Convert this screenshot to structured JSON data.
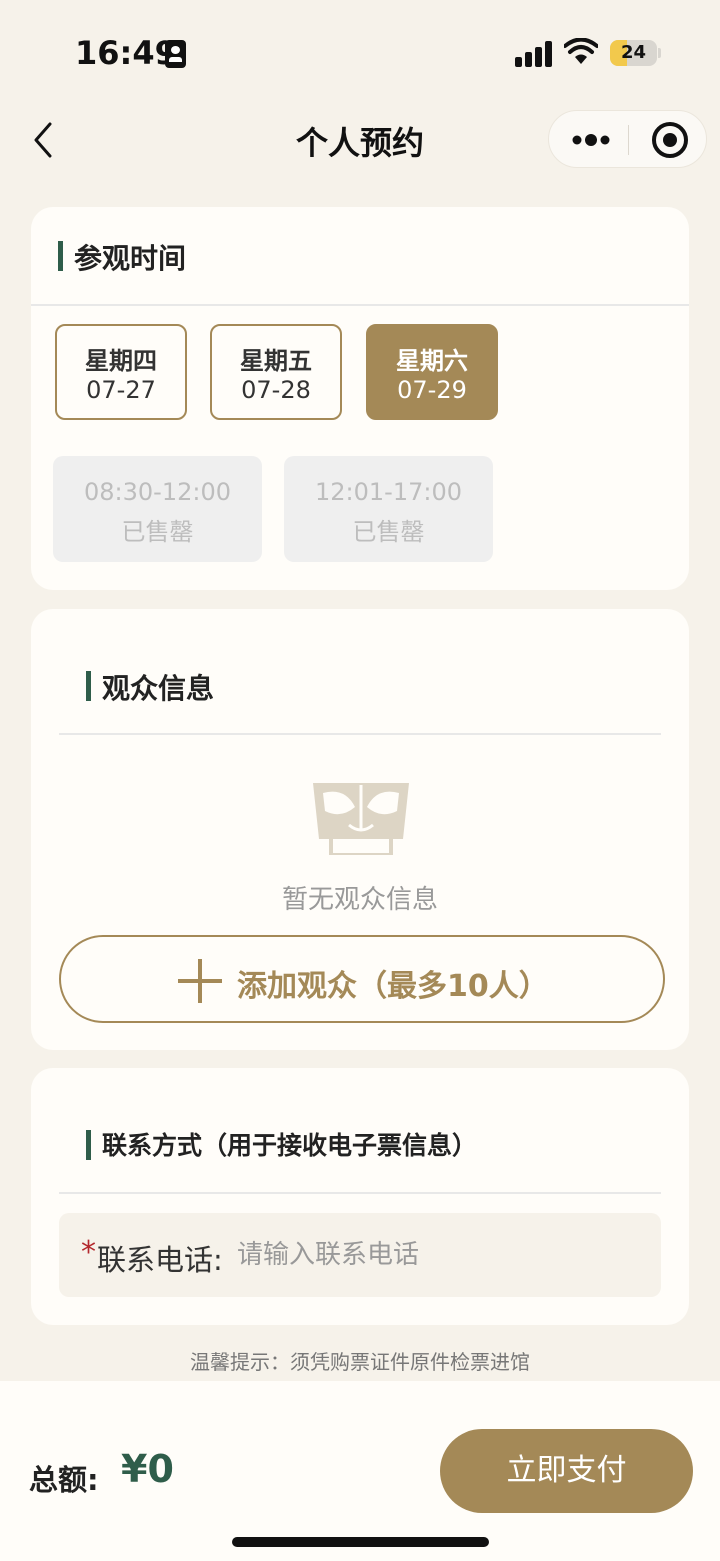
{
  "status_bar": {
    "time": "16:49",
    "battery": "24"
  },
  "nav": {
    "title": "个人预约"
  },
  "visit_time": {
    "title": "参观时间",
    "dates": [
      {
        "weekday": "星期四",
        "date": "07-27",
        "selected": false
      },
      {
        "weekday": "星期五",
        "date": "07-28",
        "selected": false
      },
      {
        "weekday": "星期六",
        "date": "07-29",
        "selected": true
      }
    ],
    "slots": [
      {
        "time": "08:30-12:00",
        "status": "已售罄"
      },
      {
        "time": "12:01-17:00",
        "status": "已售罄"
      }
    ]
  },
  "audience": {
    "title": "观众信息",
    "empty_text": "暂无观众信息",
    "add_label": "添加观众（最多10人）"
  },
  "contact": {
    "title": "联系方式（用于接收电子票信息）",
    "required_mark": "*",
    "phone_label": "联系电话:",
    "phone_placeholder": "请输入联系电话"
  },
  "tip": "温馨提示：须凭购票证件原件检票进馆",
  "footer": {
    "total_label": "总额:",
    "total_value": "¥0",
    "pay_label": "立即支付"
  },
  "colors": {
    "accent": "#a48957",
    "green": "#2f5d4a",
    "required": "#b3282d"
  }
}
